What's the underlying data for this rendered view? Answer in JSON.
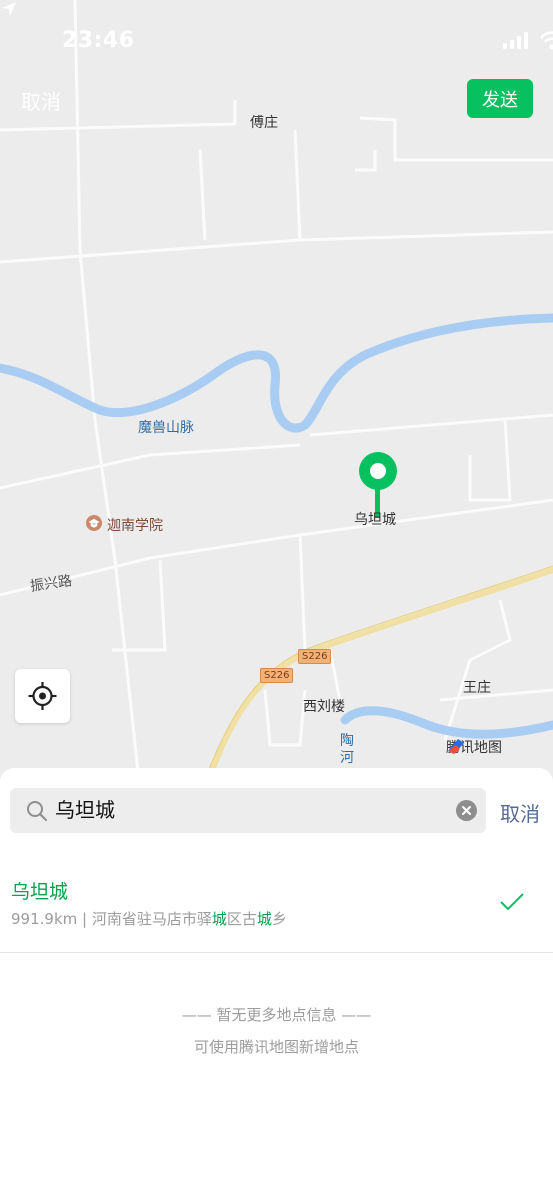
{
  "status_bar": {
    "time": "23:46"
  },
  "top_bar": {
    "cancel_label": "取消",
    "send_label": "发送"
  },
  "map": {
    "labels": {
      "fuzhuang": "傅庄",
      "moshou_mountains": "魔兽山脉",
      "jianan_school": "迦南学院",
      "zhenxing_road": "振兴路",
      "wutan_city": "乌坦城",
      "s226_a": "S226",
      "s226_b": "S226",
      "xiliu_lou": "西刘楼",
      "wangzhuang": "王庄",
      "tao_river": "陶河"
    },
    "watermark": "腾讯地图",
    "accent_color": "#07c160"
  },
  "search": {
    "value": "乌坦城",
    "cancel_label": "取消"
  },
  "results": [
    {
      "name": "乌坦城",
      "distance": "991.9km",
      "separator": " | ",
      "address_parts": [
        "河南省驻马店市驿",
        "城",
        "区古",
        "城",
        "乡"
      ],
      "selected": true
    }
  ],
  "empty_state": {
    "line1": "—— 暂无更多地点信息 ——",
    "line2": "可使用腾讯地图新增地点"
  }
}
